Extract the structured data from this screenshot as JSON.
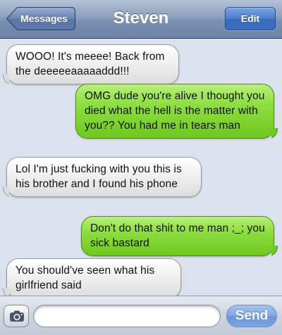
{
  "navbar": {
    "back_label": "Messages",
    "title": "Steven",
    "edit_label": "Edit"
  },
  "messages": [
    {
      "direction": "incoming",
      "text": "WOOO! It's meeee! Back from the deeeeeaaaaaddd!!!"
    },
    {
      "direction": "outgoing",
      "text": "OMG dude you're alive I thought you died what the hell is the matter with you?? You had me in tears man"
    },
    {
      "direction": "incoming",
      "text": "Lol I'm just fucking with you this is his brother and I found his phone"
    },
    {
      "direction": "outgoing",
      "text": "Don't do that shit to me man ;_; you sick bastard"
    },
    {
      "direction": "incoming",
      "text": "You should've seen what his girlfriend said"
    }
  ],
  "composer": {
    "camera_icon": "camera-icon",
    "text_value": "",
    "send_label": "Send"
  },
  "colors": {
    "incoming_bubble": "#e8e8e8",
    "outgoing_bubble": "#8fdf44",
    "background": "#dbe2ed",
    "nav_accent": "#3b6dc0"
  }
}
